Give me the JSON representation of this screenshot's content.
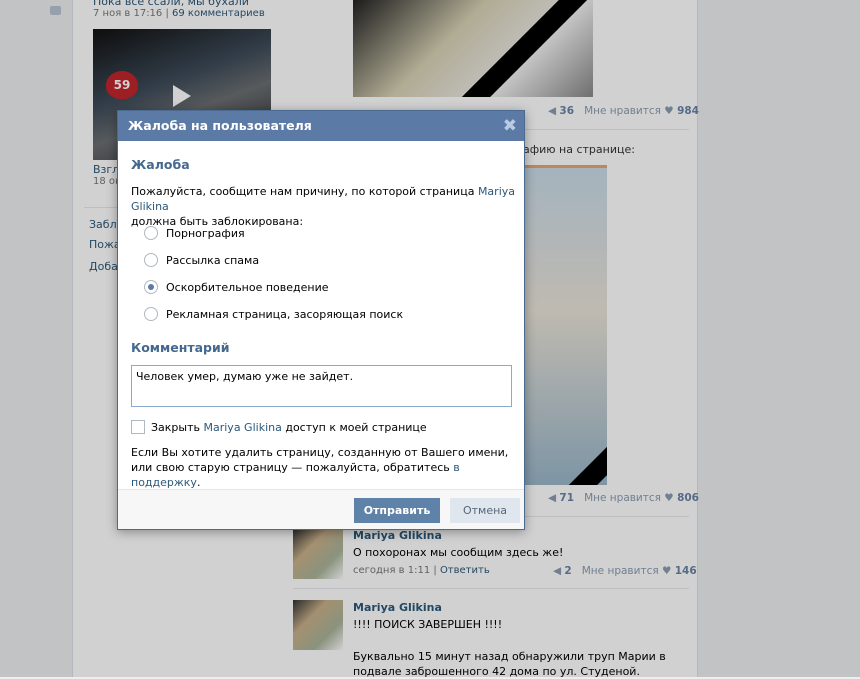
{
  "background": {
    "post_title": "Пока все ссали, мы бухали",
    "post_meta": "7 ноя в 17:16",
    "post_comments": "69 комментариев",
    "video_badge": "59",
    "video_caption": "Взгл",
    "video_date": "18 ок",
    "sidebar": [
      "Забл",
      "Пожа",
      "Доба"
    ],
    "post1": {
      "reposts": "36",
      "like_label": "Мне нравится",
      "likes": "984"
    },
    "photo_text": "афию на странице:",
    "post2": {
      "reposts": "71",
      "like_label": "Мне нравится",
      "likes": "806"
    },
    "comments": [
      {
        "author": "Mariya Glikina",
        "text": "О похоронах мы сообщим здесь же!",
        "date": "сегодня в 1:11",
        "reply": "Ответить",
        "reposts": "2",
        "like_label": "Мне нравится",
        "likes": "146"
      },
      {
        "author": "Mariya Glikina",
        "text": "!!!! ПОИСК ЗАВЕРШЕН !!!!",
        "text2": "Буквально 15 минут назад обнаружили труп Марии в подвале заброшенного 42 дома по ул. Студеной."
      }
    ]
  },
  "dialog": {
    "title": "Жалоба на пользователя",
    "section1": "Жалоба",
    "prompt_pre": "Пожалуйста, сообщите нам причину, по которой страница ",
    "user": "Mariya Glikina",
    "prompt_post": "должна быть заблокирована:",
    "reasons": [
      {
        "label": "Порнография",
        "selected": false
      },
      {
        "label": "Рассылка спама",
        "selected": false
      },
      {
        "label": "Оскорбительное поведение",
        "selected": true
      },
      {
        "label": "Рекламная страница, засоряющая поиск",
        "selected": false
      }
    ],
    "section2": "Комментарий",
    "comment": "Человек умер, думаю уже не зайдет.",
    "block_pre": "Закрыть ",
    "block_post": " доступ к моей странице",
    "note_pre": "Если Вы хотите удалить страницу, созданную от Вашего имени, или свою старую страницу — пожалуйста, обратитесь ",
    "note_link": "в поддержку",
    "note_end": ".",
    "submit": "Отправить",
    "cancel": "Отмена"
  }
}
